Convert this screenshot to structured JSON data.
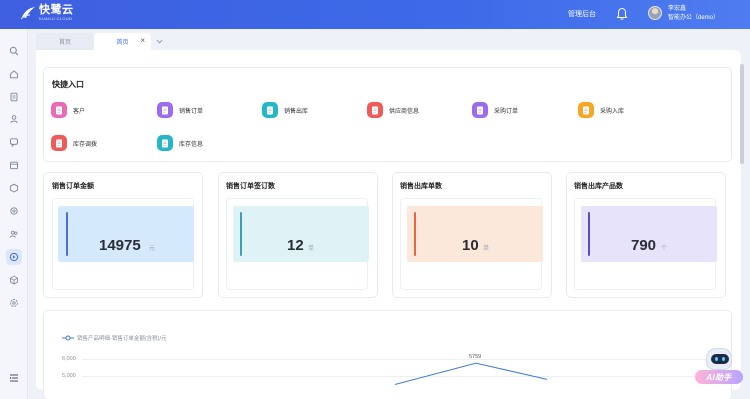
{
  "app": {
    "logo_text": "快鹭云",
    "logo_sub": "KUAILU CLOUD",
    "admin_link": "管理后台",
    "user_name": "李宏鑫",
    "user_org": "智能办公（demo）"
  },
  "sidebar": {
    "items": [
      "search-icon",
      "home-icon",
      "document-icon",
      "users-icon",
      "chat-icon",
      "calendar-icon",
      "box-icon",
      "gear-icon",
      "people-icon",
      "cube-icon",
      "cube-icon",
      "settings-icon"
    ],
    "active_index": 9
  },
  "tabs": [
    {
      "label": "首页",
      "active": false
    },
    {
      "label": "首页",
      "active": true
    }
  ],
  "quick_entry": {
    "title": "快捷入口",
    "items": [
      {
        "label": "客户",
        "color": "#e86bb5"
      },
      {
        "label": "销售订单",
        "color": "#9b6cf0"
      },
      {
        "label": "销售出库",
        "color": "#23b7c8"
      },
      {
        "label": "供应商信息",
        "color": "#ef5b57"
      },
      {
        "label": "采购订单",
        "color": "#9b6cf0"
      },
      {
        "label": "采购入库",
        "color": "#f5a623"
      },
      {
        "label": "库存调拨",
        "color": "#ef5b57"
      },
      {
        "label": "库存信息",
        "color": "#23b7c8"
      }
    ]
  },
  "stats": [
    {
      "title": "销售订单金额",
      "value": "14975",
      "unit": "元",
      "bg": "#d4eafc",
      "bar": "#4a74c9"
    },
    {
      "title": "销售订单签订数",
      "value": "12",
      "unit": "单",
      "bg": "#dff3f7",
      "bar": "#3a9fb8"
    },
    {
      "title": "销售出库单数",
      "value": "10",
      "unit": "单",
      "bg": "#fbe8da",
      "bar": "#e46a3d"
    },
    {
      "title": "销售出库产品数",
      "value": "790",
      "unit": "个",
      "bg": "#e6e3fb",
      "bar": "#5a4fb8"
    }
  ],
  "chart": {
    "legend": "销售产品明细-销售订单金额(含税)/元",
    "line_color": "#3c7be0"
  },
  "chart_data": {
    "type": "line",
    "title": "",
    "series": [
      {
        "name": "销售产品明细-销售订单金额(含税)/元",
        "values": [
          4500,
          5759,
          4800
        ]
      }
    ],
    "yticks": [
      "6,000",
      "5,000"
    ],
    "data_labels": [
      "5759"
    ]
  },
  "ai": {
    "label": "AI助手"
  }
}
